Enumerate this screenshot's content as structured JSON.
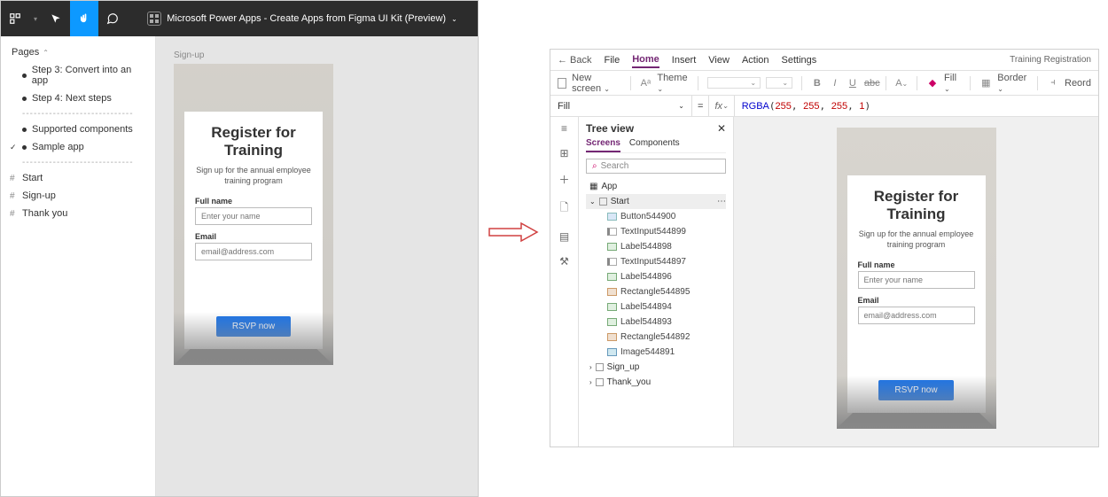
{
  "figma": {
    "title": "Microsoft Power Apps - Create Apps from Figma UI Kit (Preview)",
    "pages_label": "Pages",
    "pages": [
      {
        "label": "Step 3: Convert into an app",
        "marker": "dot"
      },
      {
        "label": "Step 4: Next steps",
        "marker": "dot"
      },
      {
        "label": "Supported components",
        "marker": "dot"
      },
      {
        "label": "Sample app",
        "marker": "check"
      }
    ],
    "frames": [
      {
        "label": "Start",
        "marker": "hash"
      },
      {
        "label": "Sign-up",
        "marker": "hash"
      },
      {
        "label": "Thank you",
        "marker": "hash"
      }
    ],
    "canvas_frame_label": "Sign-up"
  },
  "card": {
    "title_line1": "Register for",
    "title_line2": "Training",
    "subtitle": "Sign up for the annual employee training program",
    "label_name": "Full name",
    "placeholder_name": "Enter your name",
    "label_email": "Email",
    "placeholder_email": "email@address.com",
    "button": "RSVP now"
  },
  "pa": {
    "back": "Back",
    "menu": [
      "File",
      "Home",
      "Insert",
      "View",
      "Action",
      "Settings"
    ],
    "menu_active": "Home",
    "app_title": "Training Registration",
    "ribbon": {
      "new_screen": "New screen",
      "theme": "Theme",
      "fill": "Fill",
      "border": "Border",
      "reorder": "Reord"
    },
    "formula": {
      "property": "Fill",
      "fn": "RGBA",
      "args": [
        "255",
        "255",
        "255",
        "1"
      ]
    },
    "tree": {
      "title": "Tree view",
      "tab_screens": "Screens",
      "tab_components": "Components",
      "search_placeholder": "Search",
      "app_node": "App",
      "screens": [
        {
          "name": "Start",
          "expanded": true,
          "children": [
            {
              "type": "btn",
              "name": "Button544900"
            },
            {
              "type": "txt",
              "name": "TextInput544899"
            },
            {
              "type": "lbl",
              "name": "Label544898"
            },
            {
              "type": "txt",
              "name": "TextInput544897"
            },
            {
              "type": "lbl",
              "name": "Label544896"
            },
            {
              "type": "rect",
              "name": "Rectangle544895"
            },
            {
              "type": "lbl",
              "name": "Label544894"
            },
            {
              "type": "lbl",
              "name": "Label544893"
            },
            {
              "type": "rect",
              "name": "Rectangle544892"
            },
            {
              "type": "img",
              "name": "Image544891"
            }
          ]
        },
        {
          "name": "Sign_up",
          "expanded": false,
          "children": []
        },
        {
          "name": "Thank_you",
          "expanded": false,
          "children": []
        }
      ]
    }
  }
}
